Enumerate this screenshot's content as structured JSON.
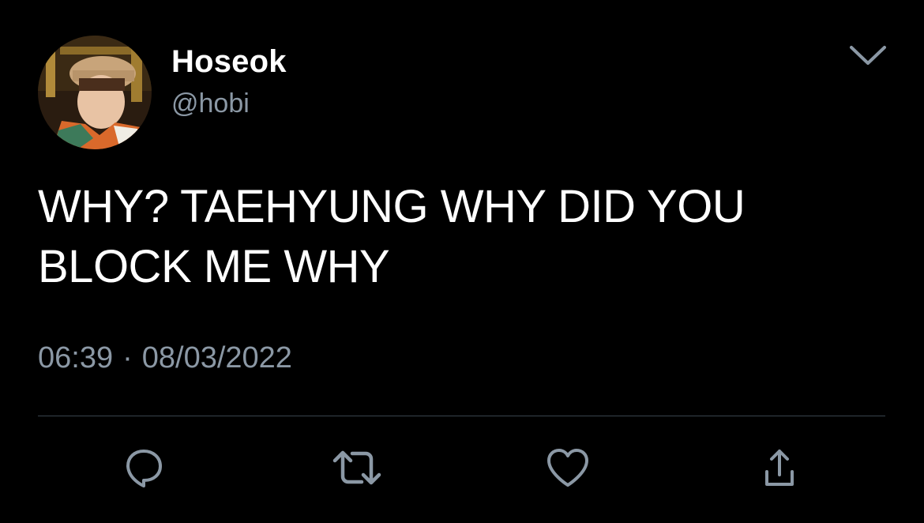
{
  "tweet": {
    "display_name": "Hoseok",
    "handle": "@hobi",
    "text": "WHY? TAEHYUNG WHY DID YOU BLOCK ME WHY",
    "time": "06:39",
    "separator": "·",
    "date": "08/03/2022",
    "avatar_icon": "user-avatar-photo",
    "menu_icon": "chevron-down-icon"
  },
  "actions": [
    {
      "name": "reply",
      "icon": "comment-icon"
    },
    {
      "name": "retweet",
      "icon": "retweet-icon"
    },
    {
      "name": "like",
      "icon": "heart-icon"
    },
    {
      "name": "share",
      "icon": "share-icon"
    }
  ],
  "colors": {
    "background": "#000000",
    "text_primary": "#ffffff",
    "text_secondary": "#8b98a5",
    "icon": "#8b98a5",
    "divider": "#38444d"
  }
}
